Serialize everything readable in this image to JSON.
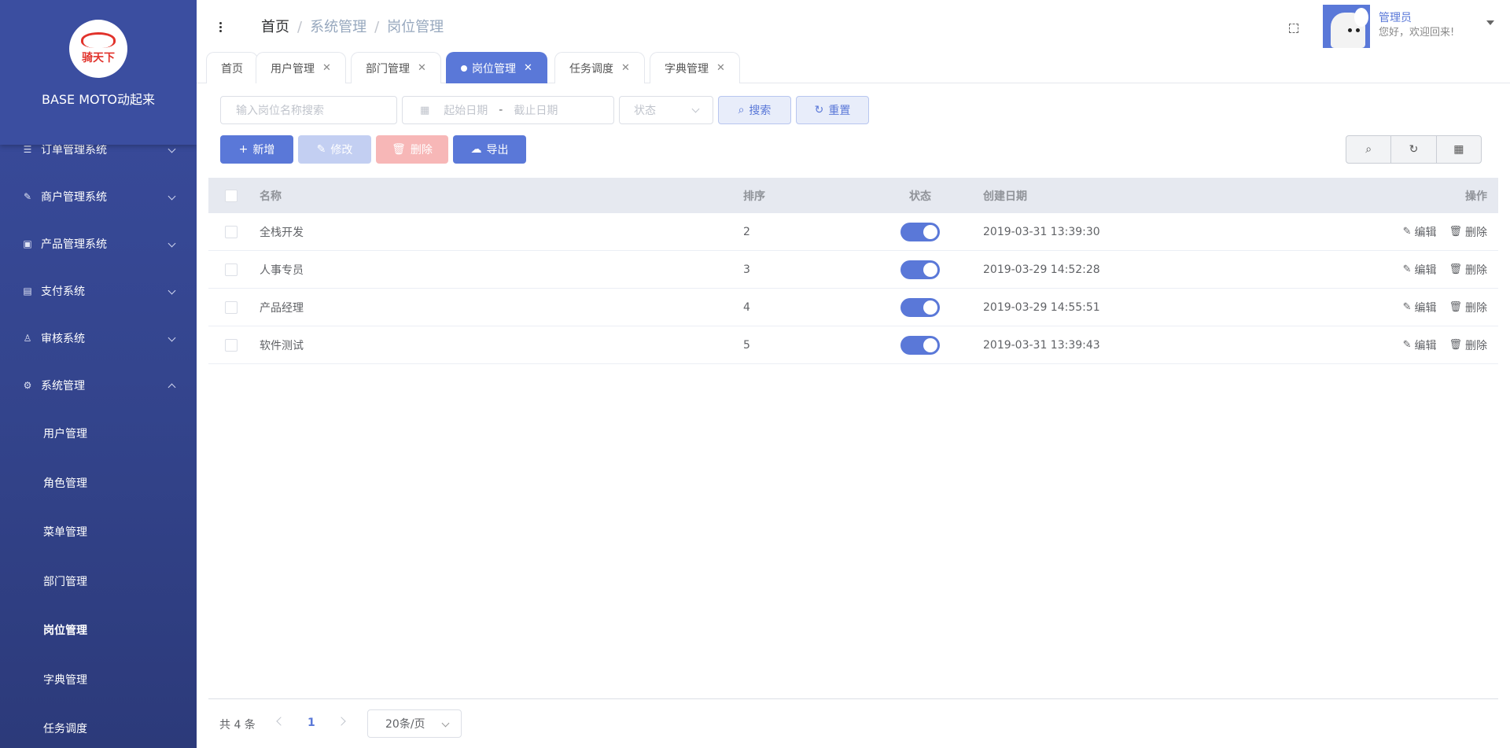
{
  "app": {
    "logo_text": "骑天下",
    "title": "BASE MOTO动起来"
  },
  "sidebar": {
    "items": [
      {
        "label": "订单管理系统",
        "icon": "list-icon",
        "expanded": false
      },
      {
        "label": "商户管理系统",
        "icon": "edit-icon",
        "expanded": false
      },
      {
        "label": "产品管理系统",
        "icon": "bag-icon",
        "expanded": false
      },
      {
        "label": "支付系统",
        "icon": "wallet-icon",
        "expanded": false
      },
      {
        "label": "审核系统",
        "icon": "user-icon",
        "expanded": false
      },
      {
        "label": "系统管理",
        "icon": "gear-icon",
        "expanded": true
      }
    ],
    "sub_items": [
      "用户管理",
      "角色管理",
      "菜单管理",
      "部门管理",
      "岗位管理",
      "字典管理",
      "任务调度"
    ],
    "active_sub": "岗位管理"
  },
  "header": {
    "breadcrumb": [
      "首页",
      "系统管理",
      "岗位管理"
    ],
    "user_name": "管理员",
    "user_greeting": "您好，欢迎回来!"
  },
  "tabs": [
    {
      "label": "首页",
      "closable": false,
      "active": false
    },
    {
      "label": "用户管理",
      "closable": true,
      "active": false
    },
    {
      "label": "部门管理",
      "closable": true,
      "active": false
    },
    {
      "label": "岗位管理",
      "closable": true,
      "active": true
    },
    {
      "label": "任务调度",
      "closable": true,
      "active": false
    },
    {
      "label": "字典管理",
      "closable": true,
      "active": false
    }
  ],
  "filters": {
    "name_placeholder": "输入岗位名称搜索",
    "start_date_placeholder": "起始日期",
    "date_separator": "-",
    "end_date_placeholder": "截止日期",
    "status_placeholder": "状态",
    "search_label": "搜索",
    "reset_label": "重置"
  },
  "toolbar": {
    "add_label": "新增",
    "edit_label": "修改",
    "delete_label": "删除",
    "export_label": "导出"
  },
  "table": {
    "headers": {
      "name": "名称",
      "sort": "排序",
      "status": "状态",
      "created": "创建日期",
      "actions": "操作"
    },
    "rows": [
      {
        "name": "全栈开发",
        "sort": "2",
        "enabled": true,
        "created": "2019-03-31 13:39:30"
      },
      {
        "name": "人事专员",
        "sort": "3",
        "enabled": true,
        "created": "2019-03-29 14:52:28"
      },
      {
        "name": "产品经理",
        "sort": "4",
        "enabled": true,
        "created": "2019-03-29 14:55:51"
      },
      {
        "name": "软件测试",
        "sort": "5",
        "enabled": true,
        "created": "2019-03-31 13:39:43"
      }
    ],
    "edit_label": "编辑",
    "delete_label": "删除"
  },
  "pagination": {
    "total_text": "共 4 条",
    "current_page": "1",
    "page_size": "20条/页"
  },
  "colors": {
    "sidebar_bg": "#34458e",
    "primary": "#5a78d8",
    "danger_disabled": "#f7b7b7"
  }
}
